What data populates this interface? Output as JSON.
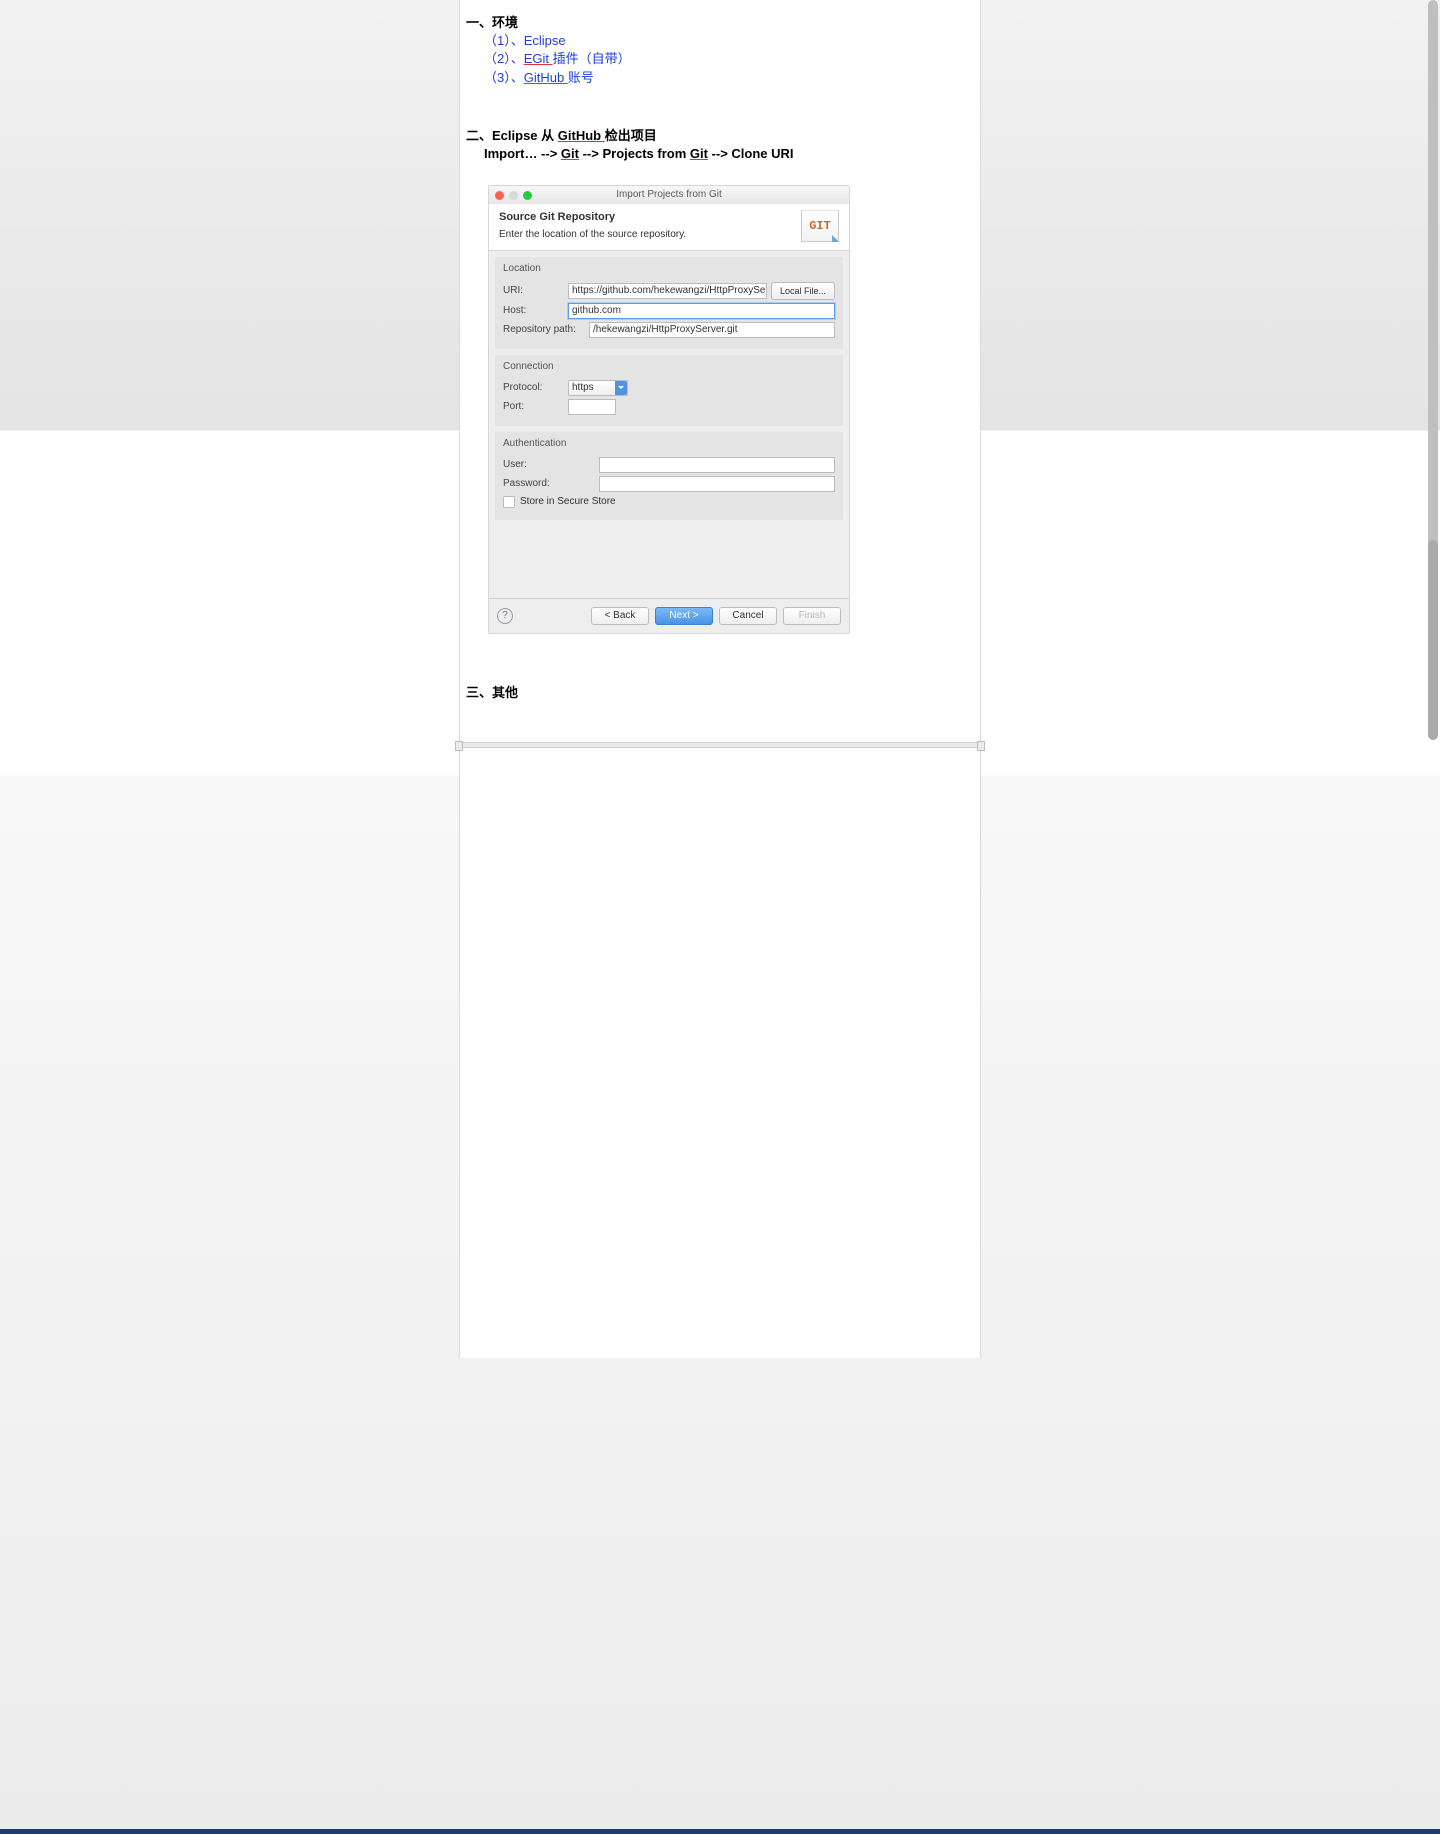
{
  "doc": {
    "s1": {
      "num": "一、",
      "title": "环境",
      "i1p": "（1）、",
      "i1": "Eclipse",
      "i2p": "（2）、",
      "i2u": "EGit ",
      "i2t": "插件（自带）",
      "i3p": "（3）、",
      "i3u": "GitHub ",
      "i3t": "账号"
    },
    "s2": {
      "num": "二、",
      "t1a": "Eclipse 从 ",
      "t1u": "GitHub ",
      "t1b": "检出项目",
      "path_a": "Import… --> ",
      "path_u1": "Git",
      "path_b": " --> Projects from ",
      "path_u2": "Git",
      "path_c": " --> Clone URI"
    },
    "s3": {
      "num": "三、",
      "title": "其他"
    }
  },
  "dialog": {
    "title": "Import Projects from Git",
    "banner_title": "Source Git Repository",
    "banner_sub": "Enter the location of the source repository.",
    "git_logo": "GIT",
    "g_location": "Location",
    "lbl_uri": "URI:",
    "val_uri": "https://github.com/hekewangzi/HttpProxyServer.git",
    "btn_local": "Local File...",
    "lbl_host": "Host:",
    "val_host": "github.com",
    "lbl_repo": "Repository path:",
    "val_repo": "/hekewangzi/HttpProxyServer.git",
    "g_conn": "Connection",
    "lbl_proto": "Protocol:",
    "val_proto": "https",
    "lbl_port": "Port:",
    "val_port": "",
    "g_auth": "Authentication",
    "lbl_user": "User:",
    "val_user": "",
    "lbl_pass": "Password:",
    "val_pass": "",
    "chk_store": "Store in Secure Store",
    "help": "?",
    "btn_back": "< Back",
    "btn_next": "Next >",
    "btn_cancel": "Cancel",
    "btn_finish": "Finish"
  }
}
